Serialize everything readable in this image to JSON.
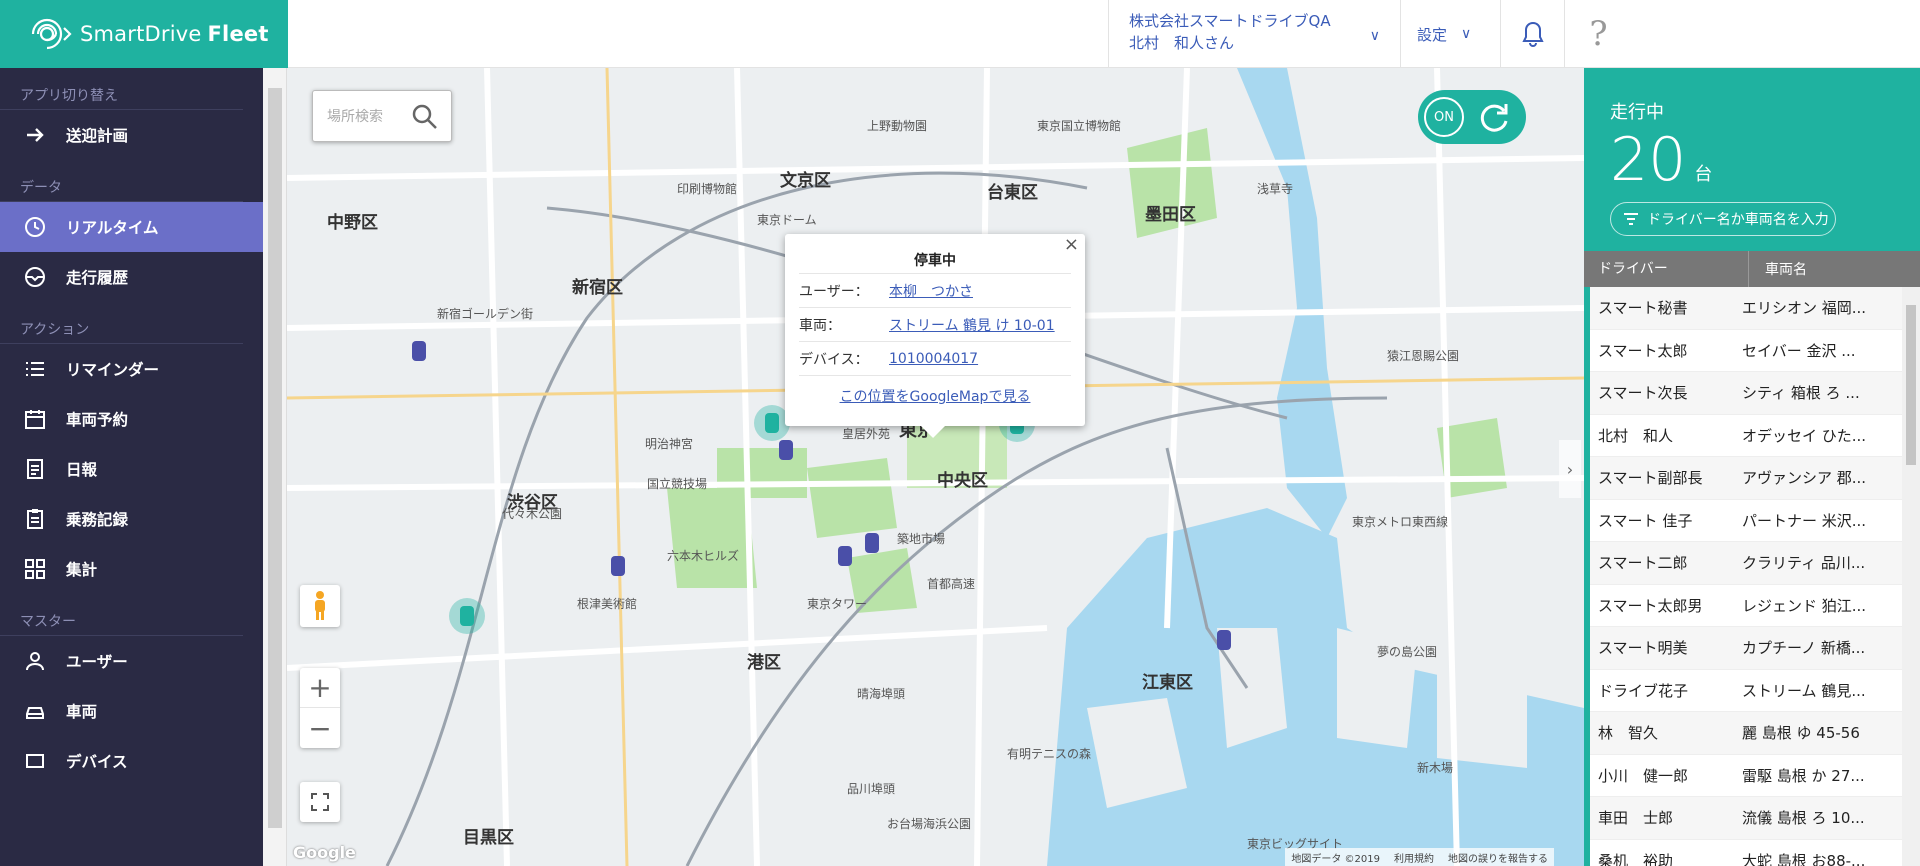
{
  "header": {
    "brand_name": "SmartDrive",
    "brand_product": "Fleet",
    "company": "株式会社スマートドライブQA",
    "user": "北村　和人さん",
    "settings_label": "設定",
    "help_glyph": "?"
  },
  "sidebar": {
    "app_switch_section": "アプリ切り替え",
    "app_switch_item": "送迎計画",
    "data_section": "データ",
    "data_items": [
      "リアルタイム",
      "走行履歴"
    ],
    "action_section": "アクション",
    "action_items": [
      "リマインダー",
      "車両予約",
      "日報",
      "乗務記録",
      "集計"
    ],
    "master_section": "マスター",
    "master_items": [
      "ユーザー",
      "車両",
      "デバイス"
    ]
  },
  "map": {
    "search_placeholder": "場所検索",
    "toggle_label": "ON",
    "google_logo": "Google",
    "attribution": [
      "地図データ ©2019",
      "利用規約",
      "地図の誤りを報告する"
    ],
    "districts": [
      "中野区",
      "文京区",
      "台東区",
      "墨田区",
      "新宿区",
      "渋谷区",
      "中央区",
      "港区",
      "江東区",
      "目黒区",
      "東京"
    ],
    "places": [
      "上野動物園",
      "東京国立博物館",
      "印刷博物館",
      "新宿ゴールデン街",
      "明治神宮",
      "皇居外苑",
      "猿江恩賜公園",
      "六本木ヒルズ",
      "東京タワー",
      "晴海埠頭",
      "有明テニスの森",
      "夢の島公園",
      "新木場",
      "お台場海浜公園",
      "代々木公園",
      "根津美術館",
      "首都高速",
      "東京ビッグサイト",
      "東京ドーム",
      "築地市場",
      "浅草寺",
      "東京メトロ東西線",
      "品川埠頭",
      "国立競技場"
    ]
  },
  "popup": {
    "title": "停車中",
    "user_label": "ユーザー：",
    "user_value": "本柳　つかさ",
    "vehicle_label": "車両：",
    "vehicle_value": "ストリーム 鶴見 け 10-01",
    "device_label": "デバイス：",
    "device_value": "1010004017",
    "google_map_link": "この位置をGoogleMapで見る",
    "close": "×"
  },
  "right_panel": {
    "status_label": "走行中",
    "count": "20",
    "unit": "台",
    "filter_placeholder": "ドライバー名か車両名を入力",
    "col_driver": "ドライバー",
    "col_vehicle": "車両名",
    "rows": [
      {
        "driver": "スマート秘書",
        "vehicle": "エリシオン 福岡..."
      },
      {
        "driver": "スマート太郎",
        "vehicle": "セイバー 金沢 ..."
      },
      {
        "driver": "スマート次長",
        "vehicle": "シティ 箱根 ろ ..."
      },
      {
        "driver": "北村　和人",
        "vehicle": "オデッセイ ひた..."
      },
      {
        "driver": "スマート副部長",
        "vehicle": "アヴァンシア 郡..."
      },
      {
        "driver": "スマート 佳子",
        "vehicle": "パートナー 米沢..."
      },
      {
        "driver": "スマート二郎",
        "vehicle": "クラリティ 品川..."
      },
      {
        "driver": "スマート太郎男",
        "vehicle": "レジェンド 狛江..."
      },
      {
        "driver": "スマート明美",
        "vehicle": "カプチーノ 新橋..."
      },
      {
        "driver": "ドライブ花子",
        "vehicle": "ストリーム 鶴見..."
      },
      {
        "driver": "林　智久",
        "vehicle": "麗 島根 ゆ 45-56"
      },
      {
        "driver": "小川　健一郎",
        "vehicle": "雷駆 島根 か 27..."
      },
      {
        "driver": "車田　士郎",
        "vehicle": "流儀 島根 ろ 10..."
      },
      {
        "driver": "桑机　裕助",
        "vehicle": "大蛇 島根 お88-..."
      }
    ]
  },
  "colors": {
    "accent": "#1fb2a0",
    "sidebar_bg": "#2a2a44",
    "sidebar_active": "#6b6fc8",
    "link": "#3b5cb8"
  }
}
